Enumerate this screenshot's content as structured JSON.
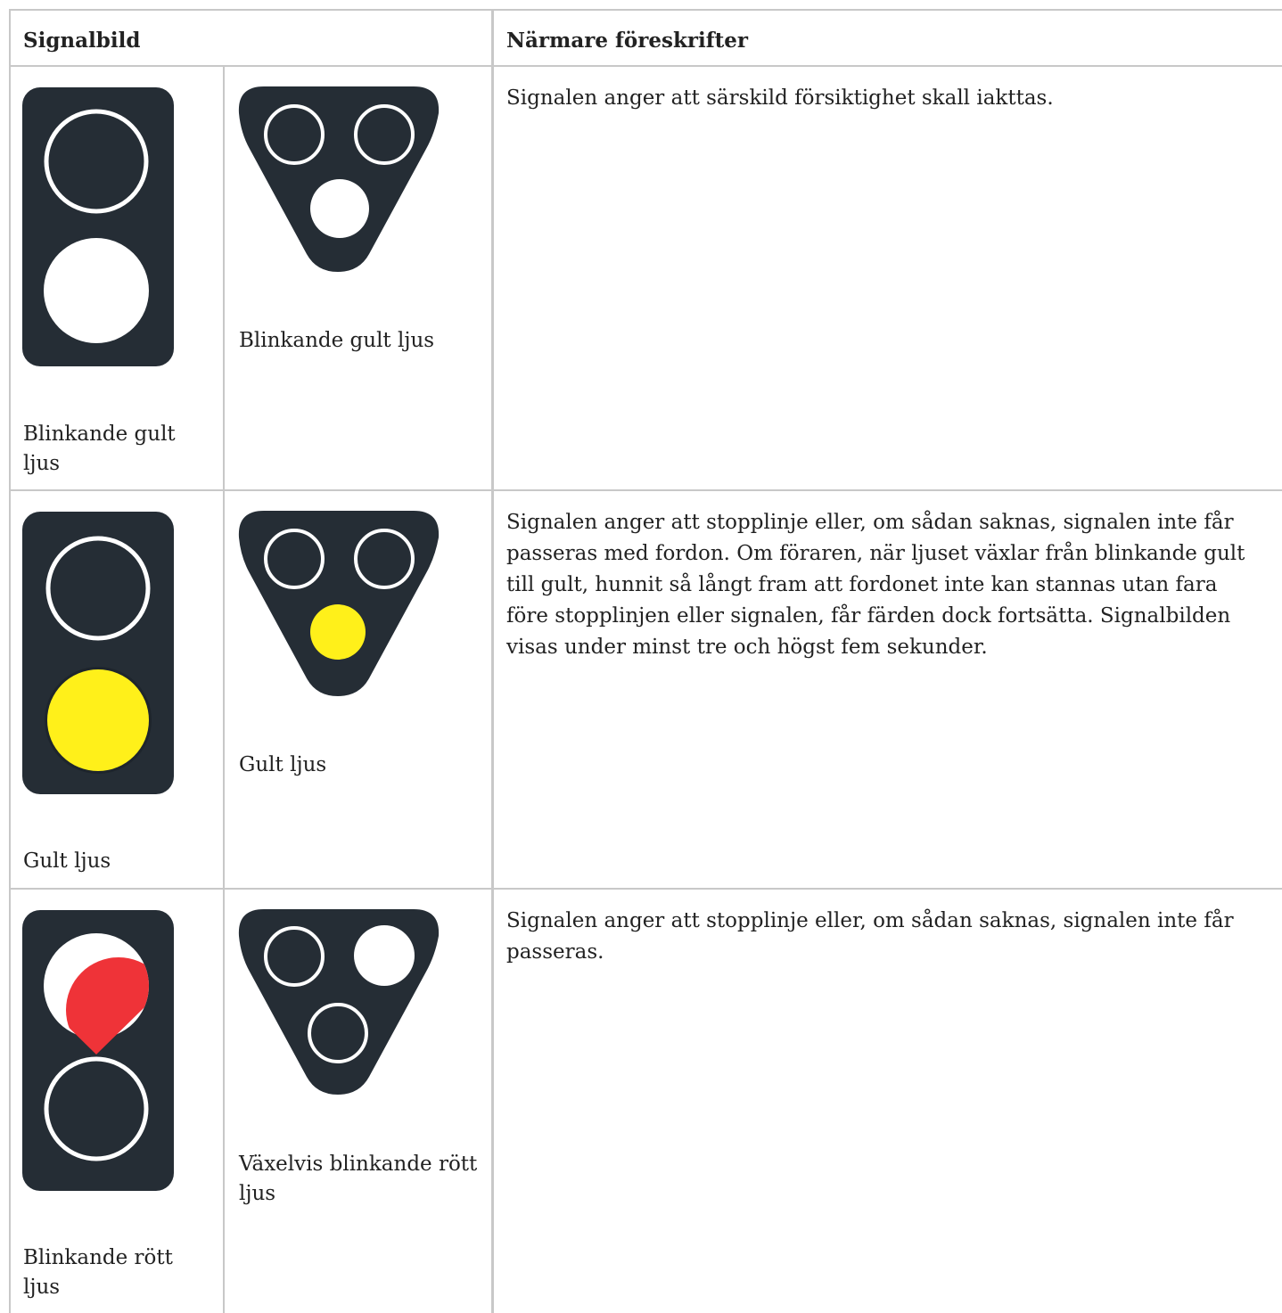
{
  "table": {
    "headers": {
      "signalbild": "Signalbild",
      "forskrifter": "Närmare föreskrifter"
    },
    "rows": [
      {
        "tall_caption": "Blinkande gult ljus",
        "tri_caption": "Blinkande gult ljus",
        "description": "Signalen anger att särskild försiktighet skall iakttas."
      },
      {
        "tall_caption": "Gult ljus",
        "tri_caption": "Gult ljus",
        "description": "Signalen anger att stopplinje eller, om sådan saknas, signalen inte får passeras med fordon. Om föraren, när ljuset växlar från blinkande gult till gult, hunnit så långt fram att fordonet inte kan stannas utan fara före stopplinjen eller signalen, får färden dock fortsätta. Signalbilden visas under minst tre och högst fem sekunder."
      },
      {
        "tall_caption": "Blinkande rött ljus",
        "tri_caption": "Växelvis blinkande rött ljus",
        "description": "Signalen anger att stopplinje eller, om sådan saknas, signalen inte får passeras."
      }
    ]
  },
  "colors": {
    "housing": "#252d35",
    "yellow": "#fff01a",
    "red": "#ef3338",
    "ring": "#ffffff",
    "grid": "#c8c8c8"
  }
}
